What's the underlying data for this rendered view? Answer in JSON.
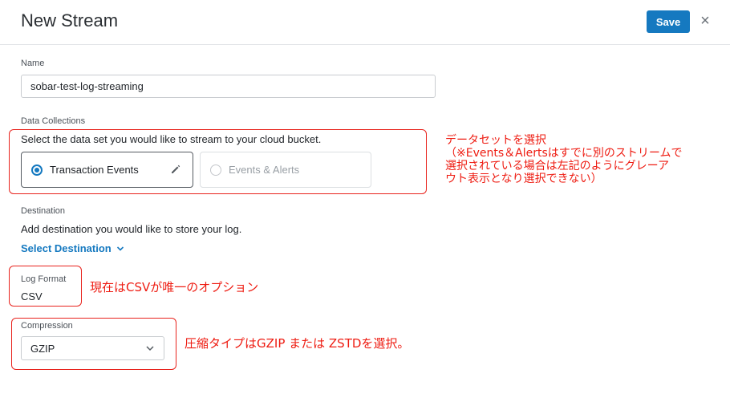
{
  "header": {
    "title": "New Stream",
    "save_label": "Save",
    "close_glyph": "×"
  },
  "name": {
    "label": "Name",
    "value": "sobar-test-log-streaming"
  },
  "data_collections": {
    "label": "Data Collections",
    "description": "Select the data set you would like to stream to your cloud bucket.",
    "options": [
      {
        "label": "Transaction Events",
        "selected": true,
        "disabled": false
      },
      {
        "label": "Events & Alerts",
        "selected": false,
        "disabled": true
      }
    ]
  },
  "destination": {
    "label": "Destination",
    "description": "Add destination you would like to store your log.",
    "select_label": "Select Destination"
  },
  "log_format": {
    "label": "Log Format",
    "value": "CSV"
  },
  "compression": {
    "label": "Compression",
    "value": "GZIP"
  },
  "annotations": {
    "dataset_note_1": "データセットを選択",
    "dataset_note_2": "（※Events＆Alertsはすでに別のストリームで",
    "dataset_note_3": "選択されている場合は左記のようにグレーア",
    "dataset_note_4": "ウト表示となり選択できない）",
    "log_note": "現在はCSVが唯一のオプション",
    "compression_note": "圧縮タイプはGZIP または ZSTDを選択。"
  },
  "colors": {
    "accent": "#1579c0",
    "annotation": "#ee1c12"
  }
}
